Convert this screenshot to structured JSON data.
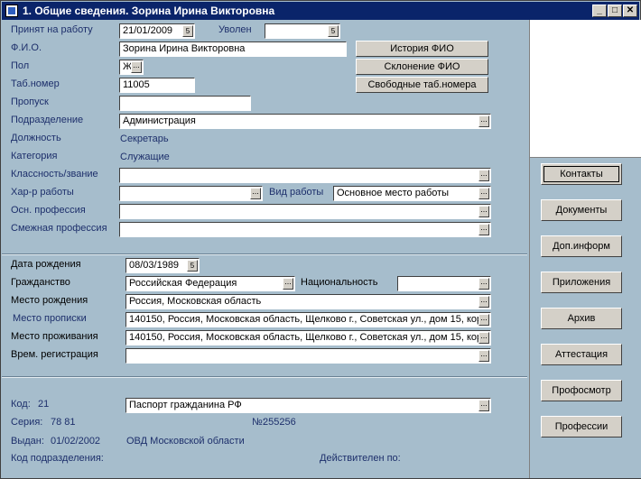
{
  "window": {
    "title": "1. Общие сведения. Зорина Ирина Викторовна"
  },
  "personal": {
    "hired_label": "Принят на работу",
    "hired_value": "21/01/2009",
    "fired_label": "Уволен",
    "fired_value": "",
    "fio_label": "Ф.И.О.",
    "fio_value": "Зорина Ирина Викторовна",
    "gender_label": "Пол",
    "gender_value": "Ж",
    "tabnum_label": "Таб.номер",
    "tabnum_value": "11005",
    "pass_label": "Пропуск",
    "pass_value": "",
    "dept_label": "Подразделение",
    "dept_value": "Администрация",
    "position_label": "Должность",
    "position_value": "Секретарь",
    "category_label": "Категория",
    "category_value": "Служащие",
    "class_label": "Классность/звание",
    "class_value": "",
    "worktype_label": "Хар-р работы",
    "worktype_value": "",
    "workkind_label": "Вид работы",
    "workkind_value": "Основное место работы",
    "mainprof_label": "Осн. профессия",
    "mainprof_value": "",
    "adjprof_label": "Смежная профессия",
    "adjprof_value": ""
  },
  "buttons": {
    "history": "История  ФИО",
    "declension": "Склонение ФИО",
    "free_tab": "Свободные таб.номера"
  },
  "birth": {
    "dob_label": "Дата рождения",
    "dob_value": "08/03/1989",
    "citizenship_label": "Гражданство",
    "citizenship_value": "Российская Федерация",
    "nationality_label": "Национальность",
    "nationality_value": "",
    "birthplace_label": "Место рождения",
    "birthplace_value": "Россия, Московская область",
    "registration_label": "Место прописки",
    "registration_value": "140150, Россия, Московская область, Щелково г., Советская ул., дом 15, кор",
    "residence_label": "Место проживания",
    "residence_value": "140150, Россия, Московская область, Щелково г., Советская ул., дом 15, кор",
    "tempreg_label": "Врем. регистрация",
    "tempreg_value": ""
  },
  "document": {
    "code_label": "Код:",
    "code_value": "21",
    "doc_value": "Паспорт гражданина РФ",
    "series_label": "Серия:",
    "series_value": "78 81",
    "number_label": "№:",
    "number_value": "255256",
    "issued_label": "Выдан:",
    "issued_value": "01/02/2002",
    "issuer_value": "ОВД Московской области",
    "deptcode_label": "Код подразделения:",
    "valid_label": "Действителен по:"
  },
  "sidebar": [
    "Контакты",
    "Документы",
    "Доп.информ",
    "Приложения",
    "Архив",
    "Аттестация",
    "Профосмотр",
    "Профессии"
  ]
}
